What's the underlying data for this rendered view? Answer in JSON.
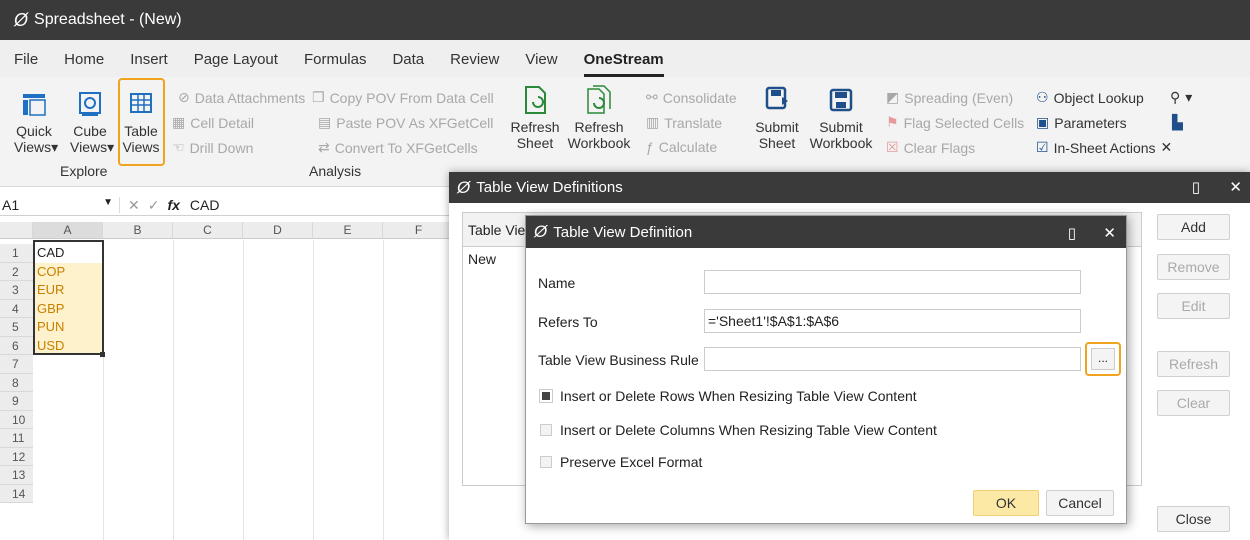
{
  "app": {
    "title": "Spreadsheet - (New)"
  },
  "menu": [
    "File",
    "Home",
    "Insert",
    "Page Layout",
    "Formulas",
    "Data",
    "Review",
    "View",
    "OneStream"
  ],
  "ribbon": {
    "quick_views": [
      "Quick",
      "Views▾"
    ],
    "cube_views": [
      "Cube",
      "Views▾"
    ],
    "table_views": [
      "Table",
      "Views"
    ],
    "explore": "Explore",
    "data_attachments": "Data Attachments",
    "cell_detail": "Cell Detail",
    "drill_down": "Drill Down",
    "copy_pov": "Copy POV From Data Cell",
    "paste_pov": "Paste POV As XFGetCell",
    "convert": "Convert To XFGetCells",
    "analysis": "Analysis",
    "refresh_sheet": [
      "Refresh",
      "Sheet"
    ],
    "refresh_workbook": [
      "Refresh",
      "Workbook"
    ],
    "consolidate": "Consolidate",
    "translate": "Translate",
    "calculate": "Calculate",
    "submit_sheet": [
      "Submit",
      "Sheet"
    ],
    "submit_workbook": [
      "Submit",
      "Workbook"
    ],
    "spreading": "Spreading (Even)",
    "flag_cells": "Flag Selected Cells",
    "clear_flags": "Clear Flags",
    "object_lookup": "Object Lookup",
    "parameters": "Parameters",
    "in_sheet_actions": "In-Sheet Actions"
  },
  "formula_bar": {
    "cell_ref": "A1",
    "value": "CAD"
  },
  "grid": {
    "columns": [
      "A",
      "B",
      "C",
      "D",
      "E",
      "F"
    ],
    "rows": [
      "1",
      "2",
      "3",
      "4",
      "5",
      "6",
      "7",
      "8",
      "9",
      "10",
      "11",
      "12",
      "13",
      "14"
    ],
    "values": [
      "CAD",
      "COP",
      "EUR",
      "GBP",
      "PUN",
      "USD"
    ]
  },
  "outer_dialog": {
    "title": "Table View Definitions",
    "column_header": "Table View",
    "row": "New",
    "buttons": {
      "add": "Add",
      "remove": "Remove",
      "edit": "Edit",
      "refresh": "Refresh",
      "clear": "Clear",
      "close": "Close"
    }
  },
  "inner_dialog": {
    "title": "Table View Definition",
    "name_label": "Name",
    "name_value": "",
    "refers_label": "Refers To",
    "refers_value": "='Sheet1'!$A$1:$A$6",
    "rule_label": "Table View Business Rule",
    "rule_value": "",
    "browse": "...",
    "opt_rows": "Insert or Delete Rows When Resizing Table View Content",
    "opt_cols": "Insert or Delete Columns When Resizing Table View Content",
    "opt_format": "Preserve Excel Format",
    "ok": "OK",
    "cancel": "Cancel"
  },
  "colors": {
    "highlight": "#f0a31e",
    "titlebar": "#3a3a3a",
    "selected_cells": "#fdf2cc",
    "ok_button": "#fde9a6"
  }
}
